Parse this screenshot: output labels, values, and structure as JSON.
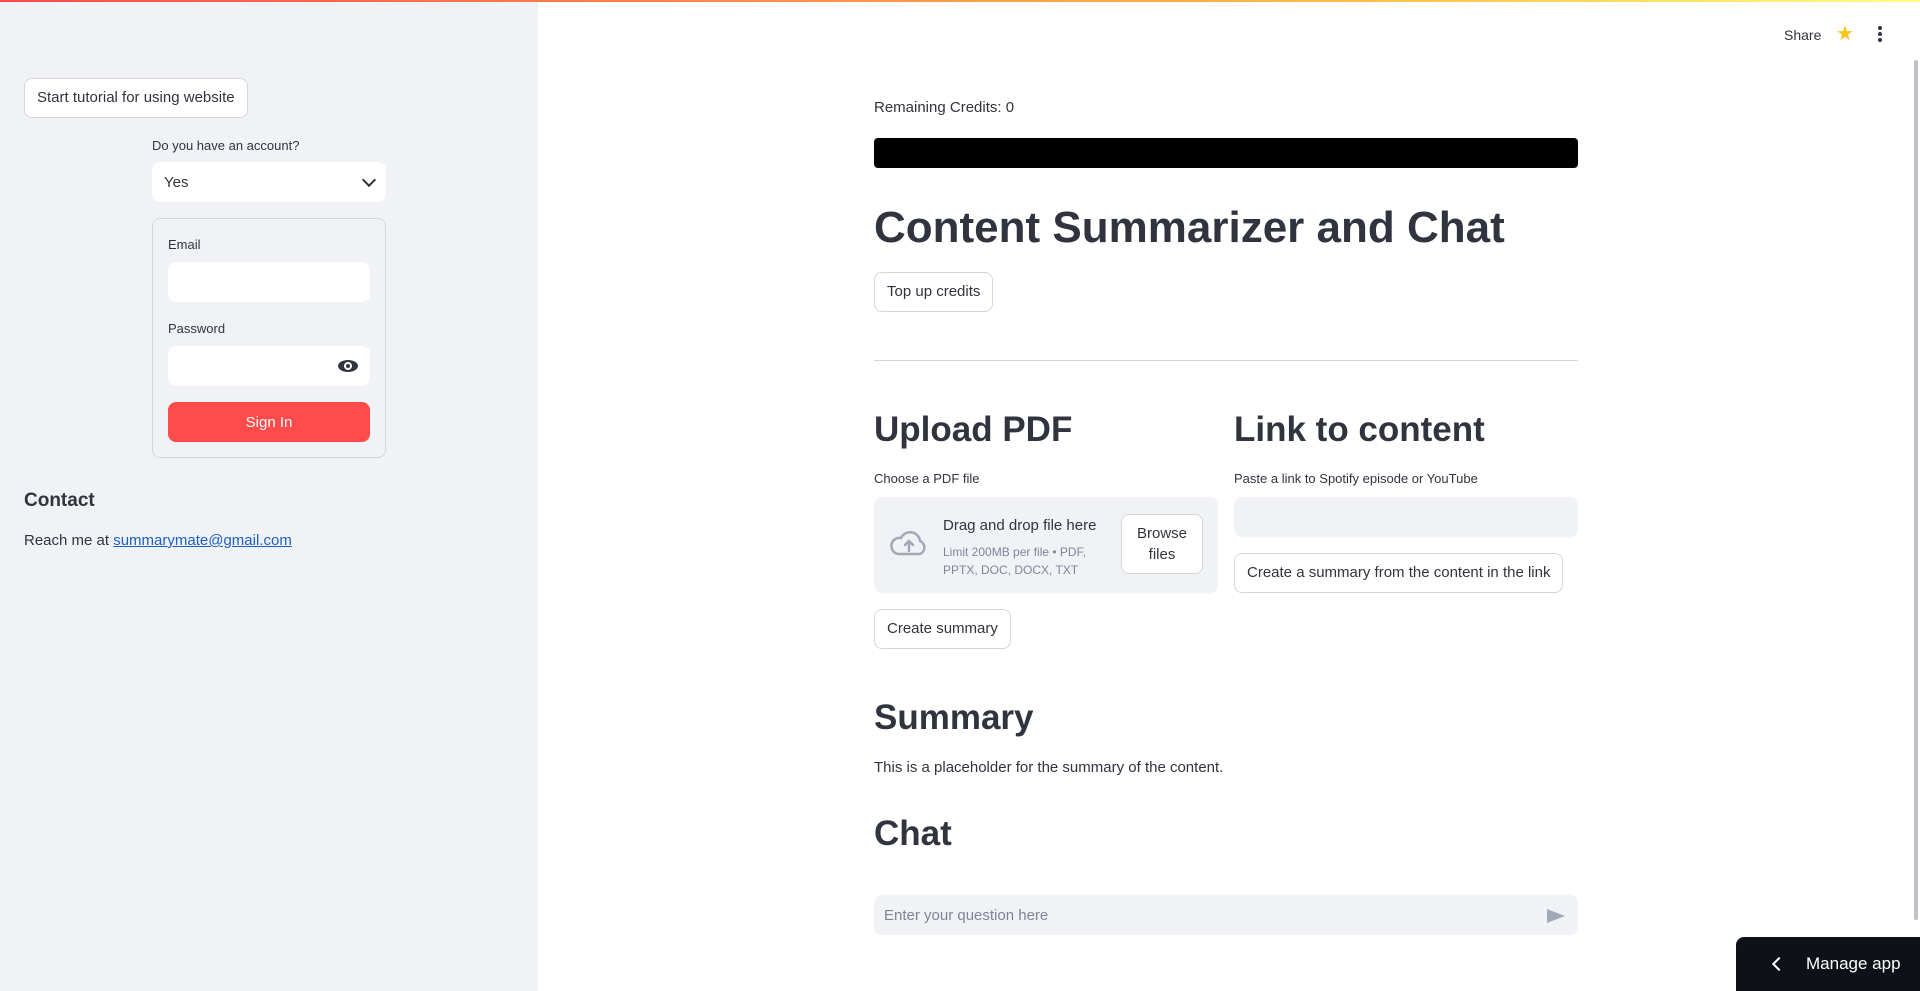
{
  "sidebar": {
    "tutorial_button": "Start tutorial for using website",
    "account_label": "Do you have an account?",
    "account_select_value": "Yes",
    "email_label": "Email",
    "password_label": "Password",
    "signin_button": "Sign In",
    "contact_title": "Contact",
    "contact_prefix": "Reach me at ",
    "contact_email": "summarymate@gmail.com"
  },
  "header": {
    "share_label": "Share",
    "star_icon": "star-icon",
    "menu_icon": "kebab-menu-icon"
  },
  "main": {
    "credits_text": "Remaining Credits: 0",
    "title": "Content Summarizer and Chat",
    "topup_button": "Top up credits",
    "upload": {
      "heading": "Upload PDF",
      "label": "Choose a PDF file",
      "drop_title": "Drag and drop file here",
      "drop_limits": "Limit 200MB per file • PDF, PPTX, DOC, DOCX, TXT",
      "browse_button": "Browse files",
      "create_button": "Create summary"
    },
    "link": {
      "heading": "Link to content",
      "label": "Paste a link to Spotify episode or YouTube",
      "create_button": "Create a summary from the content in the link"
    },
    "summary": {
      "heading": "Summary",
      "text": "This is a placeholder for the summary of the content."
    },
    "chat": {
      "heading": "Chat",
      "placeholder": "Enter your question here"
    }
  },
  "footer": {
    "manage_app": "Manage app"
  },
  "colors": {
    "primary": "#ff4b4b",
    "sidebar_bg": "#f0f2f6",
    "text": "#31333f",
    "star": "#f7c31a",
    "link": "#1c5fbf"
  }
}
